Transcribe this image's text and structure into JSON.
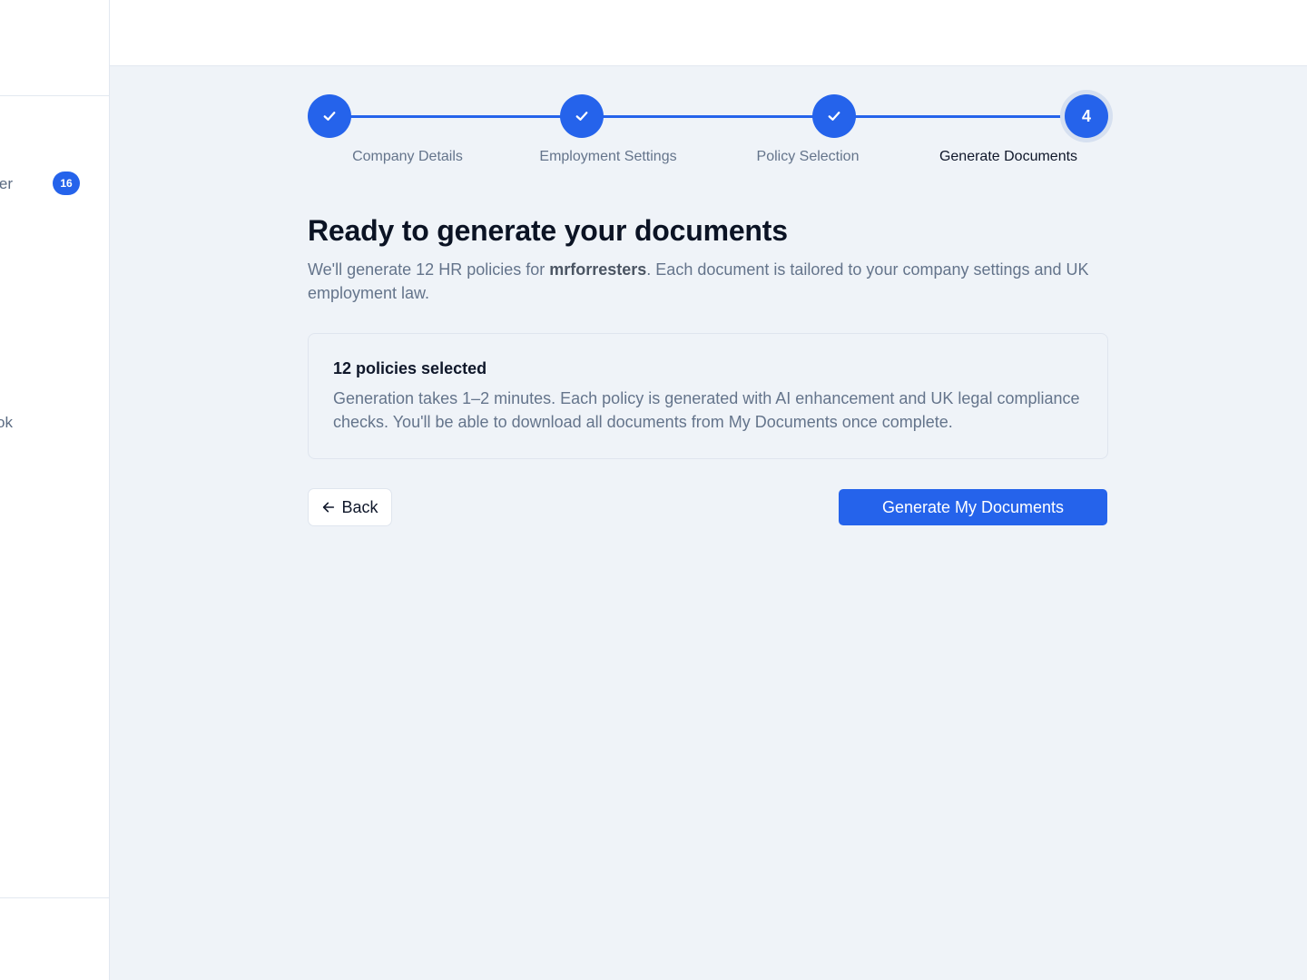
{
  "sidebar": {
    "items": [
      {
        "label": "er",
        "badge": "16"
      },
      {
        "label": "ook"
      }
    ]
  },
  "stepper": {
    "steps": [
      {
        "label": "Company Details",
        "state": "completed"
      },
      {
        "label": "Employment Settings",
        "state": "completed"
      },
      {
        "label": "Policy Selection",
        "state": "completed"
      },
      {
        "label": "Generate Documents",
        "state": "current",
        "number": "4"
      }
    ]
  },
  "main": {
    "heading": "Ready to generate your documents",
    "intro_prefix": "We'll generate 12 HR policies for ",
    "company_name": "mrforresters",
    "intro_suffix": ". Each document is tailored to your company settings and UK employment law.",
    "card": {
      "title": "12 policies selected",
      "description": "Generation takes 1–2 minutes. Each policy is generated with AI enhancement and UK legal compliance checks. You'll be able to download all documents from My Documents once complete."
    },
    "back_label": "Back",
    "generate_label": "Generate My Documents"
  },
  "colors": {
    "accent": "#2563eb",
    "background": "#eff3f8",
    "muted_text": "#64748b"
  }
}
